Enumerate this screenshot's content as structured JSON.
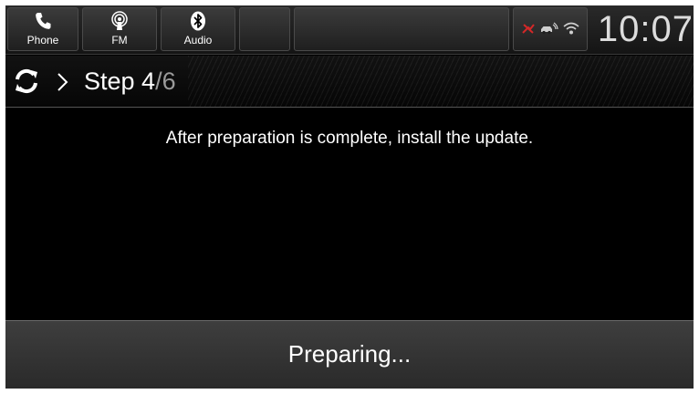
{
  "status_bar": {
    "shortcuts": [
      {
        "label": "Phone",
        "icon": "phone-icon"
      },
      {
        "label": "FM",
        "icon": "radio-icon"
      },
      {
        "label": "Audio",
        "icon": "bluetooth-icon"
      }
    ],
    "clock": "10:07",
    "status_icons": [
      "connection-error-icon",
      "car-wifi-icon",
      "wifi-icon"
    ]
  },
  "header": {
    "icon": "sync-icon",
    "step_label": "Step 4",
    "step_total": "/6"
  },
  "main": {
    "message": "After preparation is complete, install the update."
  },
  "footer": {
    "status": "Preparing..."
  },
  "colors": {
    "background": "#000000",
    "text": "#ffffff",
    "muted_text": "#9a9a9a",
    "footer": "#333333",
    "alert": "#d42828"
  }
}
